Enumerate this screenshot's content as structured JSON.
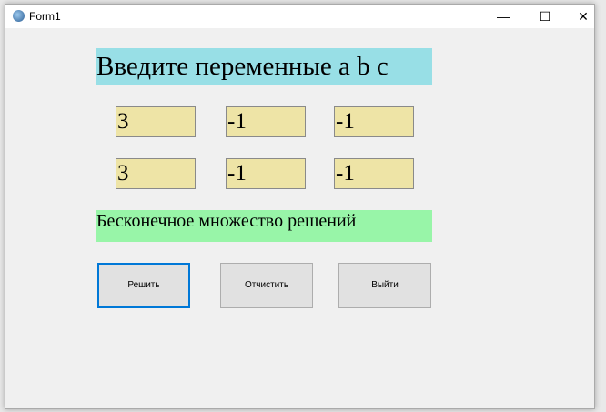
{
  "window": {
    "title": "Form1",
    "minimize": "—",
    "maximize": "☐",
    "close": "✕"
  },
  "prompt": "Введите переменные a b c",
  "inputs_row1": [
    "3",
    "-1",
    "-1"
  ],
  "inputs_row2": [
    "3",
    "-1",
    "-1"
  ],
  "result": "Бесконечное множество решений",
  "buttons": {
    "solve": "Решить",
    "clear": "Отчистить",
    "exit": "Выйти"
  }
}
